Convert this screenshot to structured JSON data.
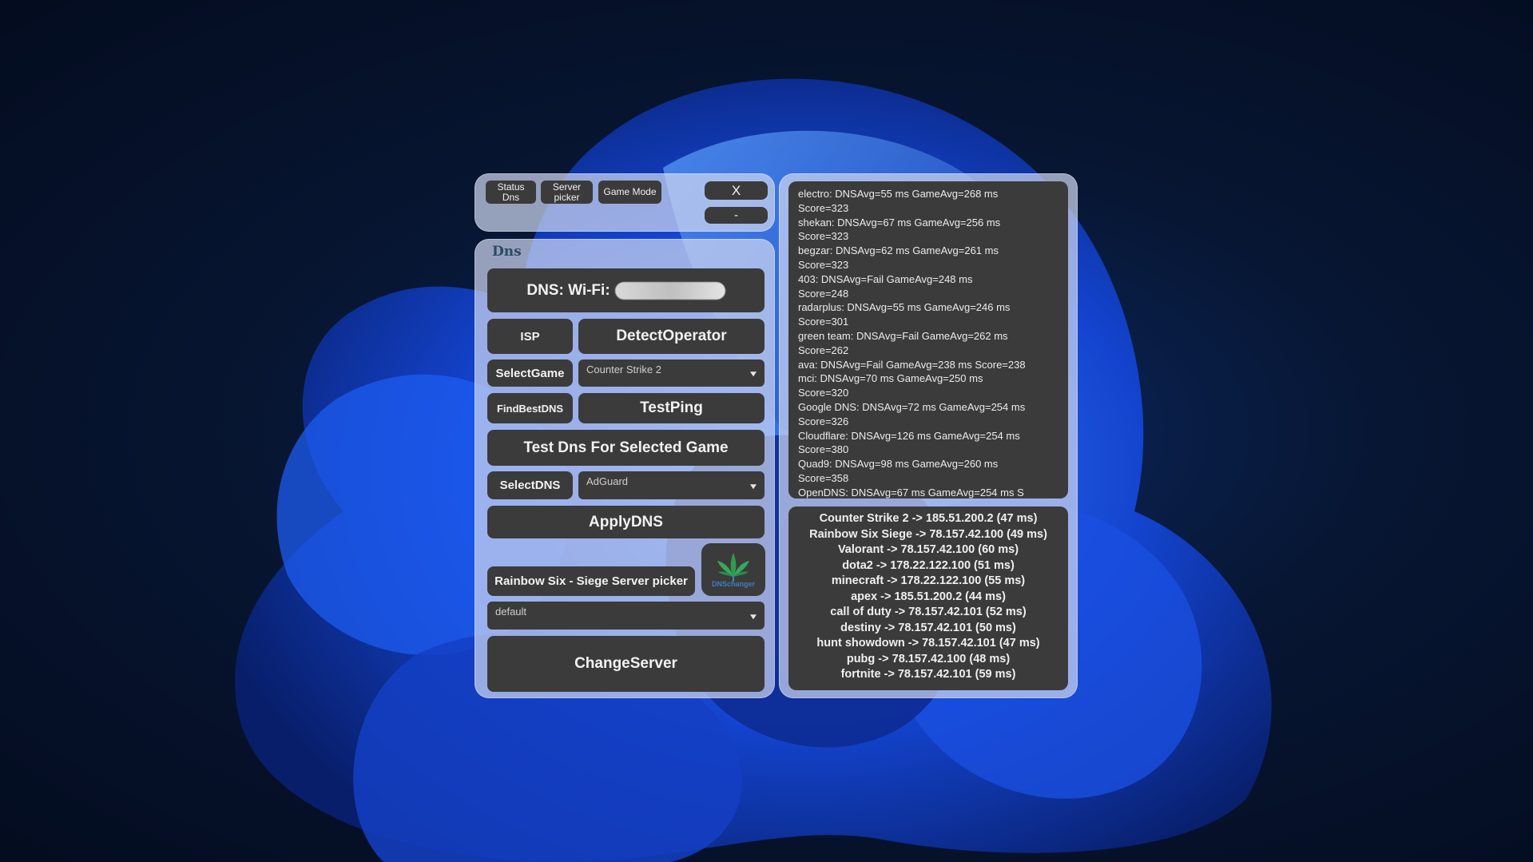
{
  "tabs": {
    "status_dns": "Status\nDns",
    "server_picker": "Server\npicker",
    "game_mode": "Game Mode",
    "close": "X",
    "minimize": "-"
  },
  "section_title": "Dns",
  "dns_status_label": "DNS: Wi-Fi:",
  "buttons": {
    "isp": "ISP",
    "detect_operator": "DetectOperator",
    "select_game": "SelectGame",
    "find_best_dns": "FindBestDNS",
    "test_ping": "TestPing",
    "test_dns_for_game": "Test Dns For Selected Game",
    "select_dns": "SelectDNS",
    "apply_dns": "ApplyDNS",
    "server_picker": "Rainbow Six - Siege Server picker",
    "change_server": "ChangeServer"
  },
  "selects": {
    "game": "Counter Strike 2",
    "dns": "AdGuard",
    "server": "default"
  },
  "logo_text": "DNSchanger",
  "log_lines": [
    "electro: DNSAvg=55 ms  GameAvg=268 ms",
    "Score=323",
    "shekan: DNSAvg=67 ms  GameAvg=256 ms",
    "Score=323",
    "begzar: DNSAvg=62 ms  GameAvg=261 ms",
    "Score=323",
    "403: DNSAvg=Fail  GameAvg=248 ms",
    "Score=248",
    "radarplus: DNSAvg=55 ms  GameAvg=246 ms",
    "Score=301",
    "green team: DNSAvg=Fail  GameAvg=262 ms",
    "Score=262",
    "ava: DNSAvg=Fail  GameAvg=238 ms  Score=238",
    "mci: DNSAvg=70 ms  GameAvg=250 ms",
    "Score=320",
    "Google DNS: DNSAvg=72 ms  GameAvg=254 ms",
    "Score=326",
    "Cloudflare: DNSAvg=126 ms  GameAvg=254 ms",
    "Score=380",
    "Quad9: DNSAvg=98 ms  GameAvg=260 ms",
    "Score=358",
    "OpenDNS: DNSAvg=67 ms  GameAvg=254 ms  S"
  ],
  "game_results": [
    "Counter Strike 2 -> 185.51.200.2 (47 ms)",
    "Rainbow Six Siege -> 78.157.42.100 (49 ms)",
    "Valorant -> 78.157.42.100 (60 ms)",
    "dota2 -> 178.22.122.100 (51 ms)",
    "minecraft -> 178.22.122.100 (55 ms)",
    "apex -> 185.51.200.2 (44 ms)",
    "call of duty -> 78.157.42.101 (52 ms)",
    "destiny -> 78.157.42.101 (50 ms)",
    "hunt showdown -> 78.157.42.101 (47 ms)",
    "pubg -> 78.157.42.100 (48 ms)",
    "fortnite -> 78.157.42.101 (59 ms)"
  ]
}
